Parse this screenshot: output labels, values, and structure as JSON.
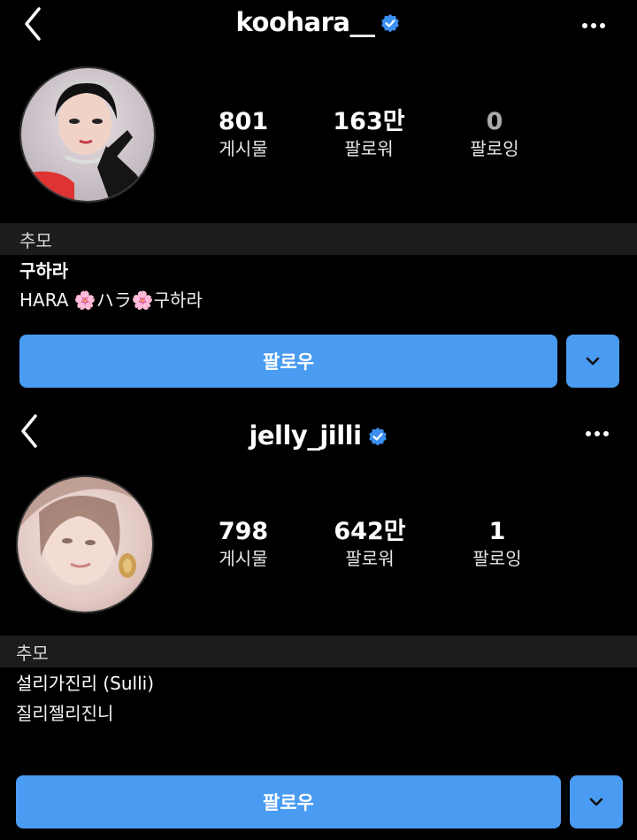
{
  "profiles": [
    {
      "username": "koohara__",
      "verified": true,
      "stats": [
        {
          "value": "801",
          "label": "게시물"
        },
        {
          "value": "163만",
          "label": "팔로워"
        },
        {
          "value": "0",
          "label": "팔로잉"
        }
      ],
      "memorial_label": "추모",
      "display_name": "구하라",
      "bio": "HARA 🌸ハラ🌸구하라",
      "follow_label": "팔로우"
    },
    {
      "username": "jelly_jilli",
      "verified": true,
      "stats": [
        {
          "value": "798",
          "label": "게시물"
        },
        {
          "value": "642만",
          "label": "팔로워"
        },
        {
          "value": "1",
          "label": "팔로잉"
        }
      ],
      "memorial_label": "추모",
      "display_name": "설리가진리 (Sulli)",
      "bio": "질리젤리진니",
      "follow_label": "팔로우"
    }
  ],
  "colors": {
    "background": "#000000",
    "accent": "#4a9bf2",
    "verified": "#3b8ff0",
    "memorial_bar": "#1c1c1c"
  }
}
